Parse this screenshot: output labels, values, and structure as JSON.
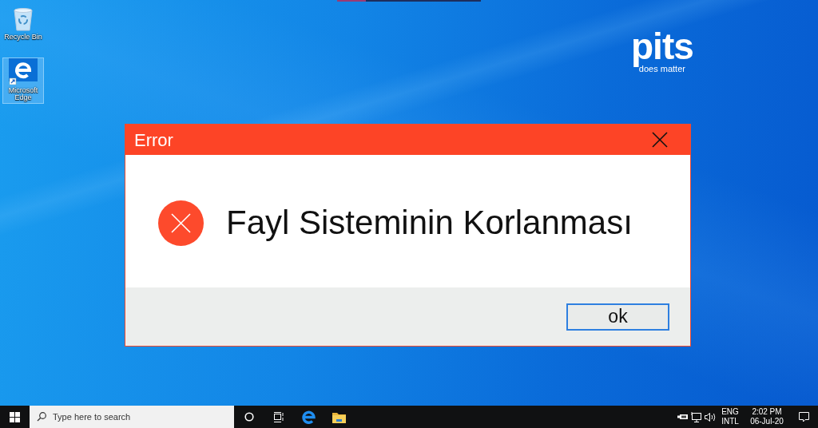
{
  "desktop": {
    "icons": [
      {
        "kind": "recycle-bin",
        "label": "Recycle Bin",
        "selected": false
      },
      {
        "kind": "browser",
        "label": "Microsoft Edge",
        "selected": true
      }
    ],
    "logo": {
      "text": "pits",
      "tagline": "does matter"
    }
  },
  "dialog": {
    "title": "Error",
    "message": "Fayl Sisteminin Korlanması",
    "buttons": [
      {
        "label": "ok",
        "focused": true
      }
    ]
  },
  "taskbar": {
    "search": {
      "placeholder": "Type here to search"
    },
    "language": [
      "ENG",
      "INTL"
    ],
    "clock": {
      "time": "2:02 PM",
      "date": "06-Jul-20"
    }
  }
}
